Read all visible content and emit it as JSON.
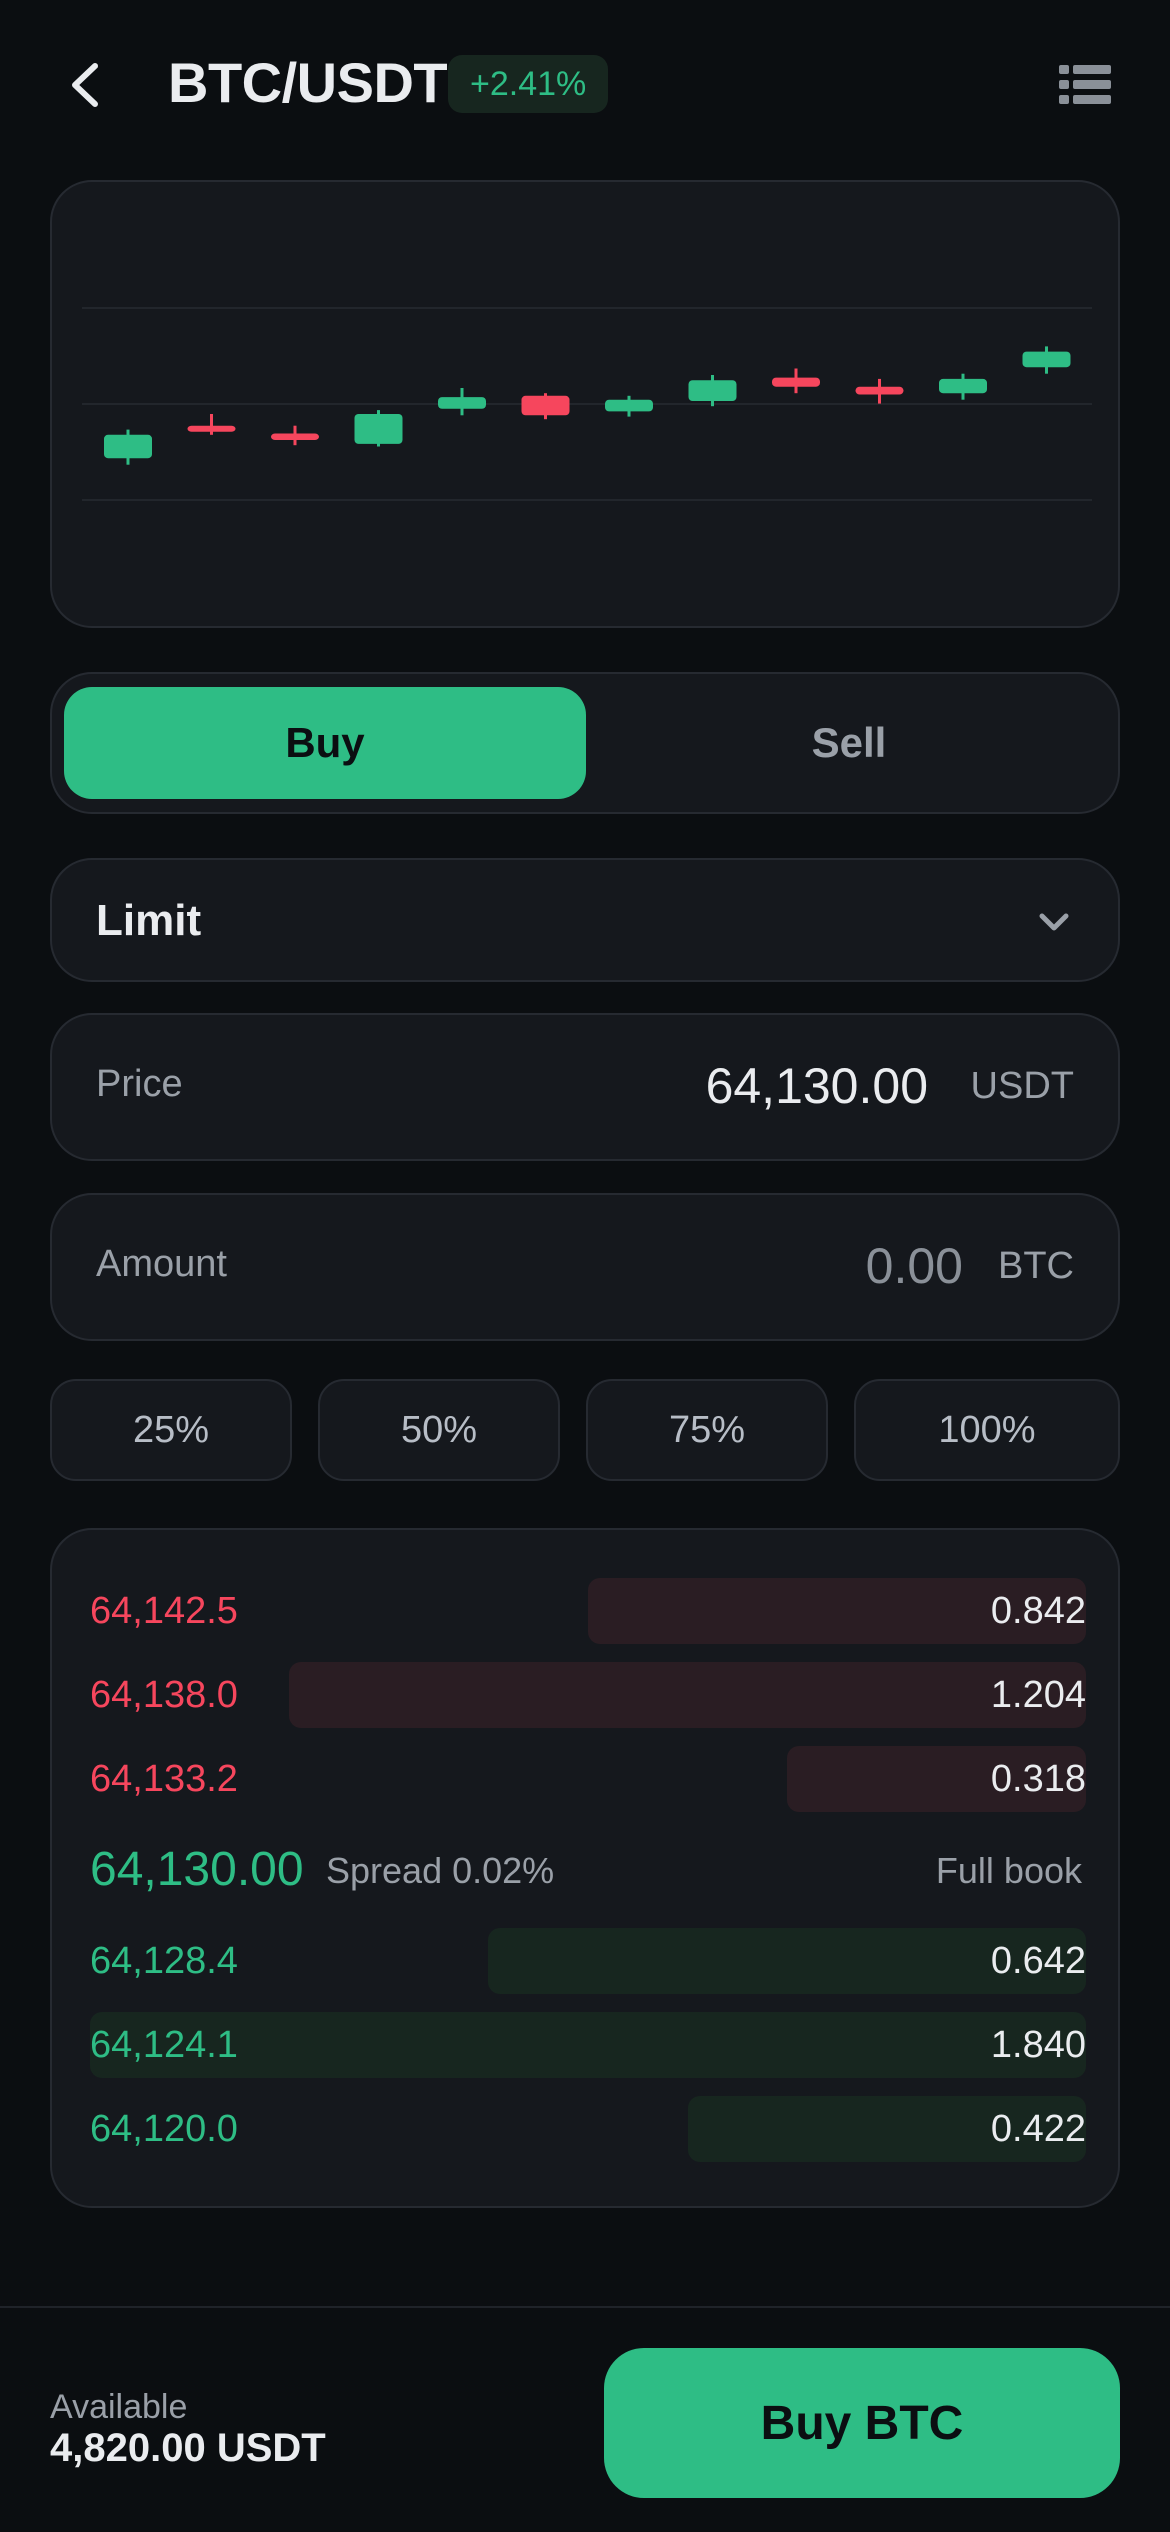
{
  "header": {
    "back_icon": "chevron-left-icon",
    "title": "BTC/USDT",
    "change": "+2.41%",
    "menu_icon": "list-menu-icon"
  },
  "colors": {
    "background": "#0b0e11",
    "card": "#15181d",
    "border": "#262a31",
    "green": "#2ebd85",
    "red": "#f6465d",
    "text": "#eaecef",
    "muted": "#9aa0a8"
  },
  "chart_data": {
    "type": "candlestick",
    "grid": true,
    "ylim": [
      0,
      100
    ],
    "candles": [
      {
        "open": 26,
        "close": 44,
        "high": 48,
        "low": 21,
        "up": true
      },
      {
        "open": 51,
        "close": 48,
        "high": 60,
        "low": 44,
        "up": false
      },
      {
        "open": 45,
        "close": 40,
        "high": 51,
        "low": 36,
        "up": false
      },
      {
        "open": 37,
        "close": 60,
        "high": 63,
        "low": 35,
        "up": true
      },
      {
        "open": 64,
        "close": 73,
        "high": 80,
        "low": 59,
        "up": true
      },
      {
        "open": 74,
        "close": 59,
        "high": 76,
        "low": 56,
        "up": false
      },
      {
        "open": 62,
        "close": 71,
        "high": 74,
        "low": 58,
        "up": true
      },
      {
        "open": 70,
        "close": 86,
        "high": 90,
        "low": 66,
        "up": true
      },
      {
        "open": 88,
        "close": 81,
        "high": 95,
        "low": 76,
        "up": false
      },
      {
        "open": 81,
        "close": 75,
        "high": 87,
        "low": 68,
        "up": false
      },
      {
        "open": 76,
        "close": 87,
        "high": 91,
        "low": 71,
        "up": true
      },
      {
        "open": 96,
        "close": 108,
        "high": 112,
        "low": 91,
        "up": true
      }
    ]
  },
  "trade": {
    "buy_label": "Buy",
    "sell_label": "Sell",
    "order_type": "Limit",
    "order_type_icon": "chevron-down-icon",
    "price_label": "Price",
    "price_value": "64,130.00",
    "price_unit": "USDT",
    "amount_label": "Amount",
    "amount_value": "0.00",
    "amount_unit": "BTC",
    "percent_buttons": [
      "25%",
      "50%",
      "75%",
      "100%"
    ]
  },
  "order_book": {
    "asks": [
      {
        "price": "64,142.5",
        "size": "0.842",
        "depth": 0.5
      },
      {
        "price": "64,138.0",
        "size": "1.204",
        "depth": 0.8
      },
      {
        "price": "64,133.2",
        "size": "0.318",
        "depth": 0.3
      }
    ],
    "mid_price": "64,130.00",
    "spread": "Spread 0.02%",
    "full_book_label": "Full book",
    "bids": [
      {
        "price": "64,128.4",
        "size": "0.642",
        "depth": 0.6
      },
      {
        "price": "64,124.1",
        "size": "1.840",
        "depth": 1.0
      },
      {
        "price": "64,120.0",
        "size": "0.422",
        "depth": 0.4
      }
    ]
  },
  "footer": {
    "available_label": "Available",
    "available_value": "4,820.00 USDT",
    "buy_button_label": "Buy BTC"
  }
}
